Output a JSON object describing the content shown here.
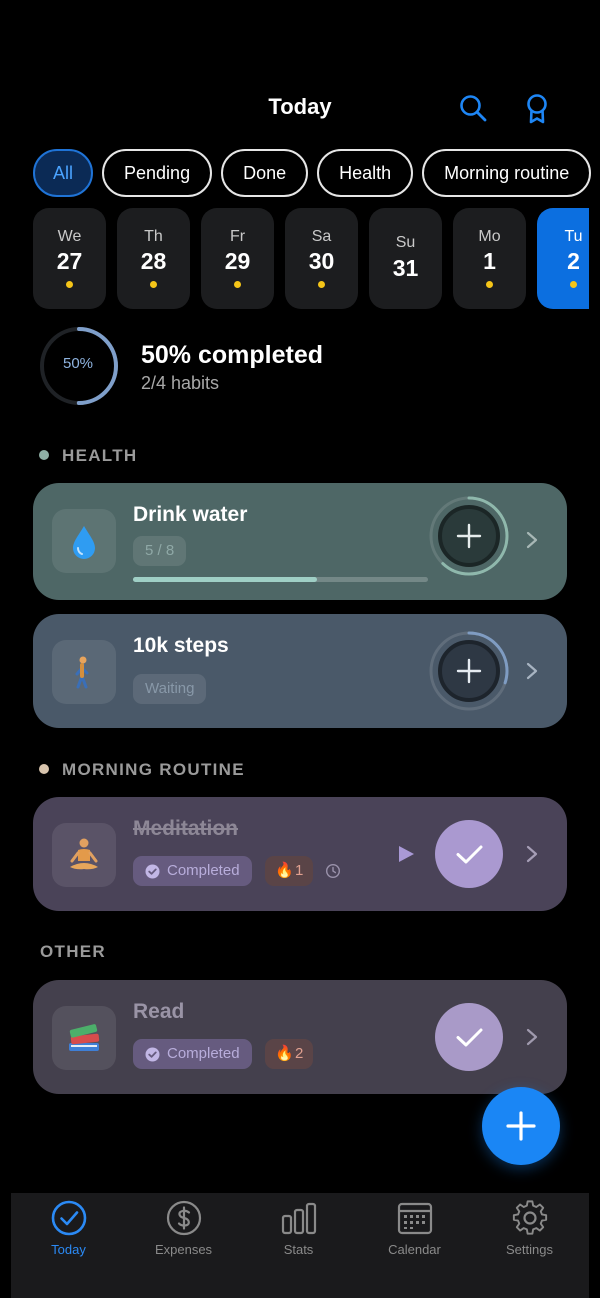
{
  "header": {
    "title": "Today",
    "icons": [
      "search-icon",
      "award-icon"
    ]
  },
  "filters": [
    {
      "label": "All",
      "active": true
    },
    {
      "label": "Pending",
      "active": false
    },
    {
      "label": "Done",
      "active": false
    },
    {
      "label": "Health",
      "active": false
    },
    {
      "label": "Morning routine",
      "active": false
    }
  ],
  "days": [
    {
      "name": "We",
      "date": "27",
      "dot": true,
      "selected": false
    },
    {
      "name": "Th",
      "date": "28",
      "dot": true,
      "selected": false
    },
    {
      "name": "Fr",
      "date": "29",
      "dot": true,
      "selected": false
    },
    {
      "name": "Sa",
      "date": "30",
      "dot": true,
      "selected": false
    },
    {
      "name": "Su",
      "date": "31",
      "dot": false,
      "selected": false
    },
    {
      "name": "Mo",
      "date": "1",
      "dot": true,
      "selected": false
    },
    {
      "name": "Tu",
      "date": "2",
      "dot": true,
      "selected": true
    }
  ],
  "progress": {
    "ring_label": "50%",
    "percent": 0.5,
    "title": "50% completed",
    "subtitle": "2/4 habits"
  },
  "sections": {
    "health": {
      "label": "HEALTH",
      "color": "#8fb0a6"
    },
    "morning": {
      "label": "MORNING ROUTINE",
      "color": "#d8c4ad"
    },
    "other": {
      "label": "OTHER"
    }
  },
  "habits": {
    "water": {
      "title": "Drink water",
      "count": "5 / 8",
      "progress": 0.625,
      "icon": "droplet-icon",
      "ring_progress": 0.62,
      "ring_color": "#8fb8ac"
    },
    "steps": {
      "title": "10k steps",
      "status": "Waiting",
      "icon": "walking-person-icon",
      "ring_progress": 0.3,
      "ring_color": "#7f9cc2"
    },
    "meditation": {
      "title": "Meditation",
      "status": "Completed",
      "streak": "1",
      "icon": "meditation-icon"
    },
    "read": {
      "title": "Read",
      "status": "Completed",
      "streak": "2",
      "icon": "books-icon"
    }
  },
  "colors": {
    "accent": "#1a86f5",
    "dot": "#f5c518"
  },
  "nav": [
    {
      "label": "Today",
      "icon": "check-circle-icon",
      "active": true
    },
    {
      "label": "Expenses",
      "icon": "dollar-circle-icon",
      "active": false
    },
    {
      "label": "Stats",
      "icon": "bar-chart-icon",
      "active": false
    },
    {
      "label": "Calendar",
      "icon": "calendar-icon",
      "active": false
    },
    {
      "label": "Settings",
      "icon": "gear-icon",
      "active": false
    }
  ]
}
